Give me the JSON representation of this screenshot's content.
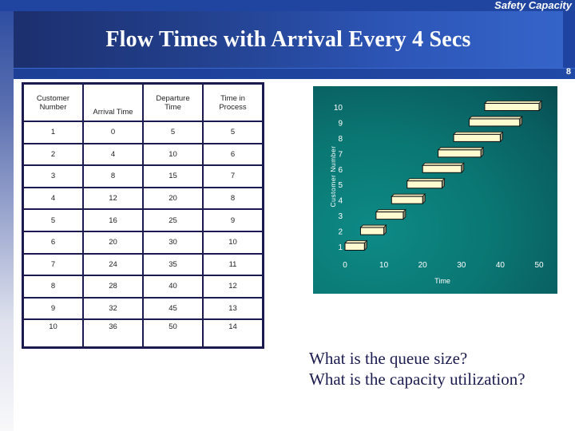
{
  "header": {
    "section_label": "Safety Capacity",
    "title": "Flow Times with Arrival Every 4 Secs",
    "page_number": "8"
  },
  "table": {
    "headers": [
      "Customer Number",
      "Arrival Time",
      "Departure Time",
      "Time in Process"
    ],
    "header_lines": [
      [
        "Customer",
        "Number"
      ],
      [
        "Arrival Time"
      ],
      [
        "Departure",
        "Time"
      ],
      [
        "Time in",
        "Process"
      ]
    ],
    "rows": [
      [
        "1",
        "0",
        "5",
        "5"
      ],
      [
        "2",
        "4",
        "10",
        "6"
      ],
      [
        "3",
        "8",
        "15",
        "7"
      ],
      [
        "4",
        "12",
        "20",
        "8"
      ],
      [
        "5",
        "16",
        "25",
        "9"
      ],
      [
        "6",
        "20",
        "30",
        "10"
      ],
      [
        "7",
        "24",
        "35",
        "11"
      ],
      [
        "8",
        "28",
        "40",
        "12"
      ],
      [
        "9",
        "32",
        "45",
        "13"
      ],
      [
        "10",
        "36",
        "50",
        "14"
      ]
    ]
  },
  "chart_data": {
    "type": "bar",
    "orientation": "horizontal-floating",
    "title": "",
    "xlabel": "Time",
    "ylabel": "Customer Number",
    "xlim": [
      0,
      50
    ],
    "ylim": [
      1,
      10
    ],
    "x_ticks": [
      "0",
      "10",
      "20",
      "30",
      "40",
      "50"
    ],
    "y_ticks": [
      "1",
      "2",
      "3",
      "4",
      "5",
      "6",
      "7",
      "8",
      "9",
      "10"
    ],
    "grid": false,
    "legend": "none",
    "colors": {
      "background": "#0a7773",
      "bar_fill": "#fffbd0",
      "bar_edge": "#111111",
      "text": "#ffffff"
    },
    "bars": [
      {
        "customer": 1,
        "start": 0,
        "end": 5
      },
      {
        "customer": 2,
        "start": 4,
        "end": 10
      },
      {
        "customer": 3,
        "start": 8,
        "end": 15
      },
      {
        "customer": 4,
        "start": 12,
        "end": 20
      },
      {
        "customer": 5,
        "start": 16,
        "end": 25
      },
      {
        "customer": 6,
        "start": 20,
        "end": 30
      },
      {
        "customer": 7,
        "start": 24,
        "end": 35
      },
      {
        "customer": 8,
        "start": 28,
        "end": 40
      },
      {
        "customer": 9,
        "start": 32,
        "end": 45
      },
      {
        "customer": 10,
        "start": 36,
        "end": 50
      }
    ]
  },
  "questions": [
    "What is the queue size?",
    "What is the capacity utilization?"
  ]
}
